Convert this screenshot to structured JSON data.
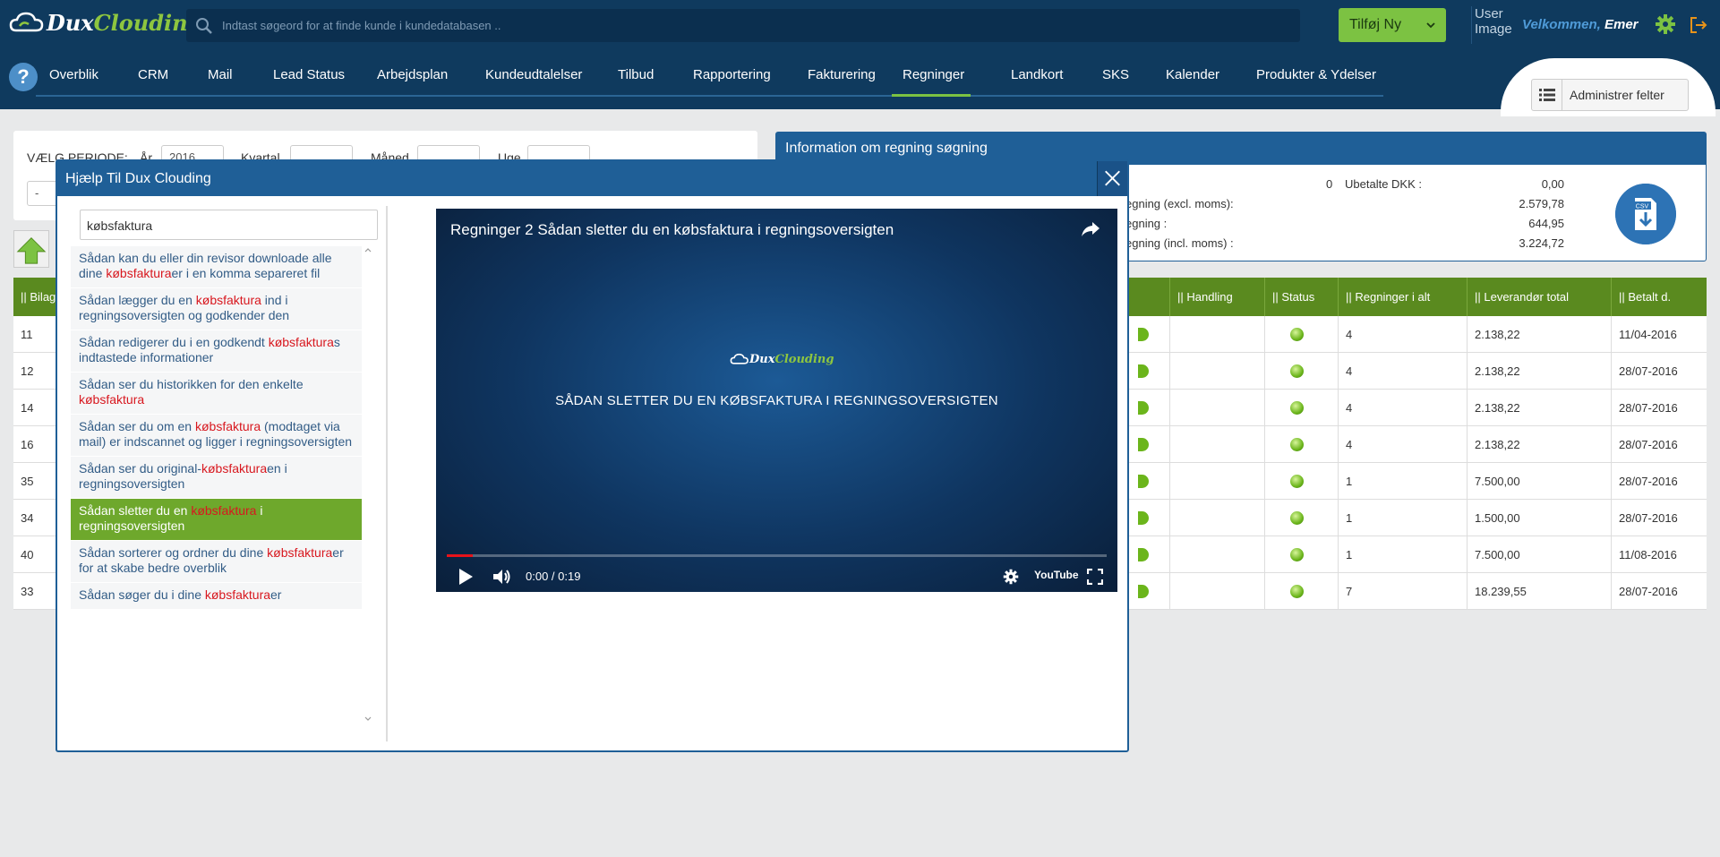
{
  "header": {
    "logo": "DuxClouding",
    "search_placeholder": "Indtast søgeord for at finde kunde i kundedatabasen ..",
    "add_new": "Tilføj Ny",
    "user_image": "User Image",
    "welcome": "Velkommen,",
    "user_name": "Emer"
  },
  "nav": {
    "items": [
      "Overblik",
      "CRM",
      "Mail",
      "Lead Status",
      "Arbejdsplan",
      "Kundeudtalelser",
      "Tilbud",
      "Rapportering",
      "Fakturering",
      "Regninger",
      "Landkort",
      "SKS",
      "Kalender",
      "Produkter & Ydelser"
    ],
    "active": "Regninger",
    "manage_fields": "Administrer felter"
  },
  "period": {
    "label": "VÆLG PERIODE:",
    "year_label": "År",
    "year_value": "2016",
    "quarter_label": "Kvartal",
    "month_label": "Måned",
    "week_label": "Uge",
    "second_value": "-"
  },
  "info": {
    "title": "Information om regning søgning",
    "count": "0",
    "unpaid_label": "Ubetalte DKK :",
    "unpaid_value": "0,00",
    "excl_label": "egning (excl. moms):",
    "excl_value": "2.579,78",
    "vat_label": "egning :",
    "vat_value": "644,95",
    "incl_label": "egning (incl. moms) :",
    "incl_value": "3.224,72",
    "csv": "CSV"
  },
  "table": {
    "headers": {
      "bilag": "|| Bilag",
      "handling": "|| Handling",
      "status": "|| Status",
      "regninger": "|| Regninger i alt",
      "leverandor": "|| Leverandør total",
      "betalt": "|| Betalt d."
    },
    "rows": [
      {
        "id": "11",
        "count": "4",
        "total": "2.138,22",
        "paid": "11/04-2016"
      },
      {
        "id": "12",
        "count": "4",
        "total": "2.138,22",
        "paid": "28/07-2016"
      },
      {
        "id": "14",
        "count": "4",
        "total": "2.138,22",
        "paid": "28/07-2016"
      },
      {
        "id": "16",
        "count": "4",
        "total": "2.138,22",
        "paid": "28/07-2016"
      },
      {
        "id": "35",
        "count": "1",
        "total": "7.500,00",
        "paid": "28/07-2016"
      },
      {
        "id": "34",
        "count": "1",
        "total": "1.500,00",
        "paid": "28/07-2016"
      },
      {
        "id": "40",
        "count": "1",
        "total": "7.500,00",
        "paid": "11/08-2016"
      },
      {
        "id": "33",
        "count": "7",
        "total": "18.239,55",
        "paid": "28/07-2016"
      }
    ]
  },
  "modal": {
    "title": "Hjælp Til Dux Clouding",
    "search_value": "købsfaktura",
    "keyword": "købsfaktura",
    "items": [
      {
        "before": "Sådan kan du eller din revisor downloade alle dine ",
        "after": "er i en komma separeret fil"
      },
      {
        "before": "Sådan lægger du en ",
        "after": " ind i regningsoversigten og godkender den"
      },
      {
        "before": "Sådan redigerer du i en godkendt ",
        "after": "s indtastede informationer"
      },
      {
        "before": "Sådan ser du historikken for den enkelte ",
        "after": ""
      },
      {
        "before": "Sådan ser du om en ",
        "after": " (modtaget via mail) er indscannet og ligger i regningsoversigten"
      },
      {
        "before": "Sådan ser du original-",
        "after": "en i regningsoversigten"
      },
      {
        "before": "Sådan sletter du en ",
        "after": " i regningsoversigten"
      },
      {
        "before": "Sådan sorterer og ordner du dine ",
        "after": "er for at skabe bedre overblik"
      },
      {
        "before": "Sådan søger du i dine ",
        "after": "er"
      }
    ],
    "active_index": 6,
    "video": {
      "title": "Regninger 2 Sådan sletter du en købsfaktura i regningsoversigten",
      "logo": "DuxClouding",
      "caption": "SÅDAN SLETTER DU EN KØBSFAKTURA I REGNINGSOVERSIGTEN",
      "time": "0:00 / 0:19",
      "progress": 0.04,
      "youtube": "YouTube"
    }
  },
  "colors": {
    "header_bg": "#0f3a5e",
    "accent_green": "#7cc242",
    "modal_blue": "#1f5f97",
    "keyword_red": "#d8181f"
  }
}
